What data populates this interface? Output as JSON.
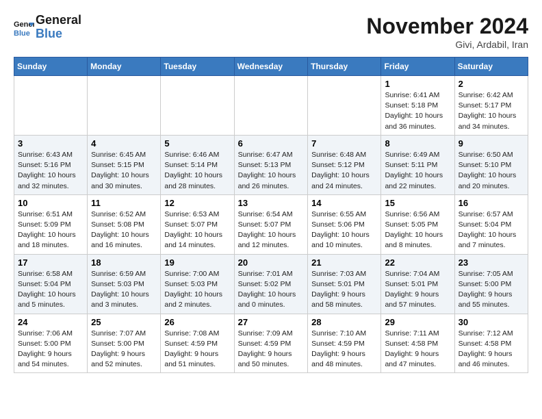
{
  "header": {
    "logo_line1": "General",
    "logo_line2": "Blue",
    "month": "November 2024",
    "location": "Givi, Ardabil, Iran"
  },
  "days_of_week": [
    "Sunday",
    "Monday",
    "Tuesday",
    "Wednesday",
    "Thursday",
    "Friday",
    "Saturday"
  ],
  "weeks": [
    [
      {
        "day": "",
        "info": ""
      },
      {
        "day": "",
        "info": ""
      },
      {
        "day": "",
        "info": ""
      },
      {
        "day": "",
        "info": ""
      },
      {
        "day": "",
        "info": ""
      },
      {
        "day": "1",
        "info": "Sunrise: 6:41 AM\nSunset: 5:18 PM\nDaylight: 10 hours\nand 36 minutes."
      },
      {
        "day": "2",
        "info": "Sunrise: 6:42 AM\nSunset: 5:17 PM\nDaylight: 10 hours\nand 34 minutes."
      }
    ],
    [
      {
        "day": "3",
        "info": "Sunrise: 6:43 AM\nSunset: 5:16 PM\nDaylight: 10 hours\nand 32 minutes."
      },
      {
        "day": "4",
        "info": "Sunrise: 6:45 AM\nSunset: 5:15 PM\nDaylight: 10 hours\nand 30 minutes."
      },
      {
        "day": "5",
        "info": "Sunrise: 6:46 AM\nSunset: 5:14 PM\nDaylight: 10 hours\nand 28 minutes."
      },
      {
        "day": "6",
        "info": "Sunrise: 6:47 AM\nSunset: 5:13 PM\nDaylight: 10 hours\nand 26 minutes."
      },
      {
        "day": "7",
        "info": "Sunrise: 6:48 AM\nSunset: 5:12 PM\nDaylight: 10 hours\nand 24 minutes."
      },
      {
        "day": "8",
        "info": "Sunrise: 6:49 AM\nSunset: 5:11 PM\nDaylight: 10 hours\nand 22 minutes."
      },
      {
        "day": "9",
        "info": "Sunrise: 6:50 AM\nSunset: 5:10 PM\nDaylight: 10 hours\nand 20 minutes."
      }
    ],
    [
      {
        "day": "10",
        "info": "Sunrise: 6:51 AM\nSunset: 5:09 PM\nDaylight: 10 hours\nand 18 minutes."
      },
      {
        "day": "11",
        "info": "Sunrise: 6:52 AM\nSunset: 5:08 PM\nDaylight: 10 hours\nand 16 minutes."
      },
      {
        "day": "12",
        "info": "Sunrise: 6:53 AM\nSunset: 5:07 PM\nDaylight: 10 hours\nand 14 minutes."
      },
      {
        "day": "13",
        "info": "Sunrise: 6:54 AM\nSunset: 5:07 PM\nDaylight: 10 hours\nand 12 minutes."
      },
      {
        "day": "14",
        "info": "Sunrise: 6:55 AM\nSunset: 5:06 PM\nDaylight: 10 hours\nand 10 minutes."
      },
      {
        "day": "15",
        "info": "Sunrise: 6:56 AM\nSunset: 5:05 PM\nDaylight: 10 hours\nand 8 minutes."
      },
      {
        "day": "16",
        "info": "Sunrise: 6:57 AM\nSunset: 5:04 PM\nDaylight: 10 hours\nand 7 minutes."
      }
    ],
    [
      {
        "day": "17",
        "info": "Sunrise: 6:58 AM\nSunset: 5:04 PM\nDaylight: 10 hours\nand 5 minutes."
      },
      {
        "day": "18",
        "info": "Sunrise: 6:59 AM\nSunset: 5:03 PM\nDaylight: 10 hours\nand 3 minutes."
      },
      {
        "day": "19",
        "info": "Sunrise: 7:00 AM\nSunset: 5:03 PM\nDaylight: 10 hours\nand 2 minutes."
      },
      {
        "day": "20",
        "info": "Sunrise: 7:01 AM\nSunset: 5:02 PM\nDaylight: 10 hours\nand 0 minutes."
      },
      {
        "day": "21",
        "info": "Sunrise: 7:03 AM\nSunset: 5:01 PM\nDaylight: 9 hours\nand 58 minutes."
      },
      {
        "day": "22",
        "info": "Sunrise: 7:04 AM\nSunset: 5:01 PM\nDaylight: 9 hours\nand 57 minutes."
      },
      {
        "day": "23",
        "info": "Sunrise: 7:05 AM\nSunset: 5:00 PM\nDaylight: 9 hours\nand 55 minutes."
      }
    ],
    [
      {
        "day": "24",
        "info": "Sunrise: 7:06 AM\nSunset: 5:00 PM\nDaylight: 9 hours\nand 54 minutes."
      },
      {
        "day": "25",
        "info": "Sunrise: 7:07 AM\nSunset: 5:00 PM\nDaylight: 9 hours\nand 52 minutes."
      },
      {
        "day": "26",
        "info": "Sunrise: 7:08 AM\nSunset: 4:59 PM\nDaylight: 9 hours\nand 51 minutes."
      },
      {
        "day": "27",
        "info": "Sunrise: 7:09 AM\nSunset: 4:59 PM\nDaylight: 9 hours\nand 50 minutes."
      },
      {
        "day": "28",
        "info": "Sunrise: 7:10 AM\nSunset: 4:59 PM\nDaylight: 9 hours\nand 48 minutes."
      },
      {
        "day": "29",
        "info": "Sunrise: 7:11 AM\nSunset: 4:58 PM\nDaylight: 9 hours\nand 47 minutes."
      },
      {
        "day": "30",
        "info": "Sunrise: 7:12 AM\nSunset: 4:58 PM\nDaylight: 9 hours\nand 46 minutes."
      }
    ]
  ]
}
